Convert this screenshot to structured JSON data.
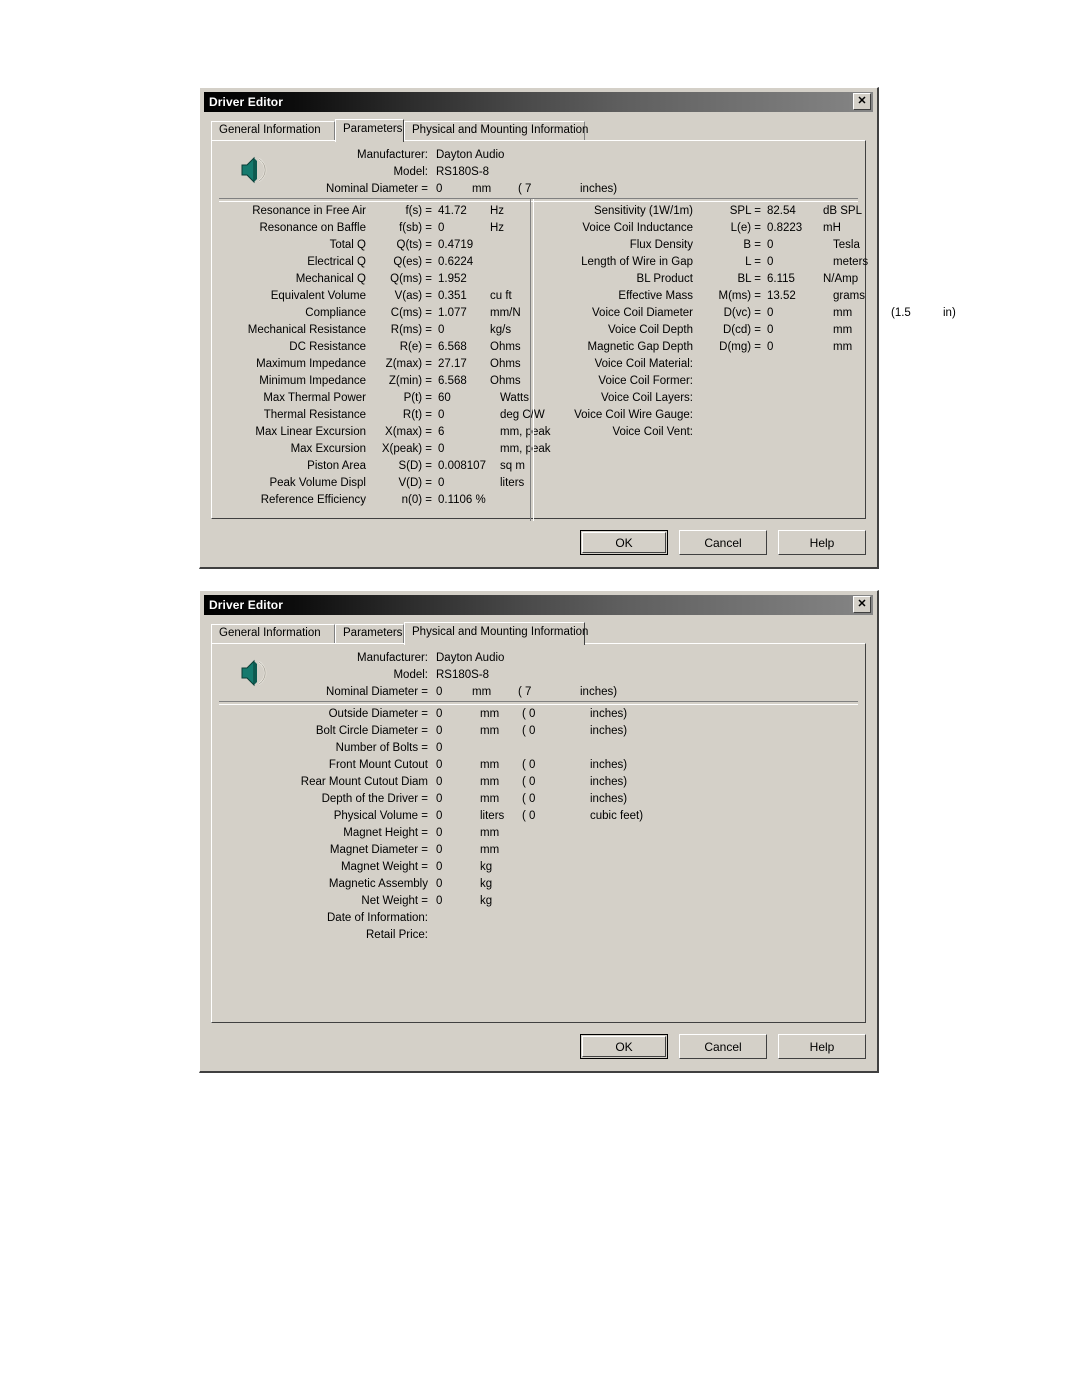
{
  "dialog1": {
    "title": "Driver Editor",
    "close_label": "✕",
    "tabs": [
      {
        "label": "General Information",
        "selected": false
      },
      {
        "label": "Parameters",
        "selected": true
      },
      {
        "label": "Physical and Mounting Information",
        "selected": false
      }
    ],
    "header": {
      "icon": "speaker-icon",
      "manufacturer_label": "Manufacturer:",
      "manufacturer_value": "Dayton Audio",
      "model_label": "Model:",
      "model_value": "RS180S-8",
      "nominal_label": "Nominal Diameter =",
      "nominal_value": "0",
      "nominal_unit": "mm",
      "nominal_paren": "( 7",
      "nominal_unit2": "inches)"
    },
    "left_params": [
      {
        "label": "Resonance in Free Air",
        "sym": "f(s) =",
        "val": "41.72",
        "unit": "Hz"
      },
      {
        "label": "Resonance on Baffle",
        "sym": "f(sb) =",
        "val": "0",
        "unit": "Hz"
      },
      {
        "label": "Total Q",
        "sym": "Q(ts) =",
        "val": "0.4719",
        "unit": ""
      },
      {
        "label": "Electrical Q",
        "sym": "Q(es) =",
        "val": "0.6224",
        "unit": ""
      },
      {
        "label": "Mechanical Q",
        "sym": "Q(ms) =",
        "val": "1.952",
        "unit": ""
      },
      {
        "label": "Equivalent Volume",
        "sym": "V(as) =",
        "val": "0.351",
        "unit": "cu ft"
      },
      {
        "label": "Compliance",
        "sym": "C(ms) =",
        "val": "1.077",
        "unit": "mm/N"
      },
      {
        "label": "Mechanical Resistance",
        "sym": "R(ms) =",
        "val": "0",
        "unit": "kg/s"
      },
      {
        "label": "DC Resistance",
        "sym": "R(e) =",
        "val": "6.568",
        "unit": "Ohms"
      },
      {
        "label": "Maximum Impedance",
        "sym": "Z(max) =",
        "val": "27.17",
        "unit": "Ohms"
      },
      {
        "label": "Minimum Impedance",
        "sym": "Z(min) =",
        "val": "6.568",
        "unit": "Ohms"
      },
      {
        "label": "Max Thermal Power",
        "sym": "P(t) =",
        "val": "60",
        "unit": "Watts",
        "unit_pad": true
      },
      {
        "label": "Thermal Resistance",
        "sym": "R(t) =",
        "val": "0",
        "unit": "deg C/W",
        "unit_pad": true
      },
      {
        "label": "Max Linear Excursion",
        "sym": "X(max) =",
        "val": "6",
        "unit": "mm, peak",
        "unit_pad": true
      },
      {
        "label": "Max Excursion",
        "sym": "X(peak) =",
        "val": "0",
        "unit": "mm, peak",
        "unit_pad": true
      },
      {
        "label": "Piston Area",
        "sym": "S(D) =",
        "val": "0.008107",
        "unit": "sq m",
        "unit_pad": true
      },
      {
        "label": "Peak Volume Displ",
        "sym": "V(D) =",
        "val": "0",
        "unit": "liters",
        "unit_pad": true
      },
      {
        "label": "Reference Efficiency",
        "sym": "n(0) =",
        "val": "0.1106 %",
        "unit": ""
      }
    ],
    "right_params": [
      {
        "label": "Sensitivity (1W/1m)",
        "sym": "SPL =",
        "val": "82.54",
        "unit": "dB SPL"
      },
      {
        "label": "Voice Coil Inductance",
        "sym": "L(e) =",
        "val": "0.8223",
        "unit": "mH"
      },
      {
        "label": "Flux Density",
        "sym": "B =",
        "val": "0",
        "unit": "Tesla",
        "unit_pad": true
      },
      {
        "label": "Length of Wire in Gap",
        "sym": "L =",
        "val": "0",
        "unit": "meters",
        "unit_pad": true
      },
      {
        "label": "BL Product",
        "sym": "BL =",
        "val": "6.115",
        "unit": "N/Amp"
      },
      {
        "label": "Effective Mass",
        "sym": "M(ms) =",
        "val": "13.52",
        "unit": "grams",
        "unit_pad": true
      },
      {
        "label": "Voice Coil Diameter",
        "sym": "D(vc) =",
        "val": "0",
        "unit": "mm",
        "unit_pad": true,
        "extra1": "(1.5",
        "extra2": "in)"
      },
      {
        "label": "Voice Coil Depth",
        "sym": "D(cd) =",
        "val": "0",
        "unit": "mm",
        "unit_pad": true
      },
      {
        "label": "Magnetic Gap Depth",
        "sym": "D(mg) =",
        "val": "0",
        "unit": "mm",
        "unit_pad": true
      },
      {
        "label": "Voice Coil Material:",
        "sym": "",
        "val": "",
        "unit": ""
      },
      {
        "label": "Voice Coil Former:",
        "sym": "",
        "val": "",
        "unit": ""
      },
      {
        "label": "Voice Coil Layers:",
        "sym": "",
        "val": "",
        "unit": ""
      },
      {
        "label": "Voice Coil Wire Gauge:",
        "sym": "",
        "val": "",
        "unit": ""
      },
      {
        "label": "Voice Coil Vent:",
        "sym": "",
        "val": "",
        "unit": ""
      }
    ],
    "buttons": {
      "ok": "OK",
      "cancel": "Cancel",
      "help": "Help"
    }
  },
  "dialog2": {
    "title": "Driver Editor",
    "close_label": "✕",
    "tabs": [
      {
        "label": "General Information",
        "selected": false
      },
      {
        "label": "Parameters",
        "selected": false
      },
      {
        "label": "Physical and Mounting Information",
        "selected": true
      }
    ],
    "header": {
      "icon": "speaker-icon",
      "manufacturer_label": "Manufacturer:",
      "manufacturer_value": "Dayton Audio",
      "model_label": "Model:",
      "model_value": "RS180S-8",
      "nominal_label": "Nominal Diameter =",
      "nominal_value": "0",
      "nominal_unit": "mm",
      "nominal_paren": "( 7",
      "nominal_unit2": "inches)"
    },
    "phys_params": [
      {
        "label": "Outside Diameter =",
        "val": "0",
        "unit": "mm",
        "extra1": "( 0",
        "extra2": "inches)"
      },
      {
        "label": "Bolt Circle Diameter =",
        "val": "0",
        "unit": "mm",
        "extra1": "( 0",
        "extra2": "inches)"
      },
      {
        "label": "Number of Bolts =",
        "val": "0",
        "unit": "",
        "extra1": "",
        "extra2": ""
      },
      {
        "label": "Front Mount Cutout",
        "val": "0",
        "unit": "mm",
        "extra1": "( 0",
        "extra2": "inches)"
      },
      {
        "label": "Rear Mount Cutout Diam",
        "val": "0",
        "unit": "mm",
        "extra1": "( 0",
        "extra2": "inches)"
      },
      {
        "label": "Depth of the Driver =",
        "val": "0",
        "unit": "mm",
        "extra1": "( 0",
        "extra2": "inches)"
      },
      {
        "label": "Physical Volume =",
        "val": "0",
        "unit": "liters",
        "extra1": "( 0",
        "extra2": "cubic feet)"
      },
      {
        "label": "Magnet Height =",
        "val": "0",
        "unit": "mm",
        "extra1": "",
        "extra2": ""
      },
      {
        "label": "Magnet Diameter =",
        "val": "0",
        "unit": "mm",
        "extra1": "",
        "extra2": ""
      },
      {
        "label": "Magnet Weight =",
        "val": "0",
        "unit": "kg",
        "extra1": "",
        "extra2": ""
      },
      {
        "label": "Magnetic Assembly",
        "val": "0",
        "unit": "kg",
        "extra1": "",
        "extra2": ""
      },
      {
        "label": "Net Weight =",
        "val": "0",
        "unit": "kg",
        "extra1": "",
        "extra2": ""
      },
      {
        "label": "Date of Information:",
        "val": "",
        "unit": "",
        "extra1": "",
        "extra2": ""
      },
      {
        "label": "Retail Price:",
        "val": "",
        "unit": "",
        "extra1": "",
        "extra2": ""
      }
    ],
    "buttons": {
      "ok": "OK",
      "cancel": "Cancel",
      "help": "Help"
    }
  },
  "colors": {
    "dialog_face": "#d4d0c8",
    "title_start": "#000000",
    "title_end": "#858585",
    "icon_teal": "#157a6e",
    "page_bg": "#ffffff"
  }
}
